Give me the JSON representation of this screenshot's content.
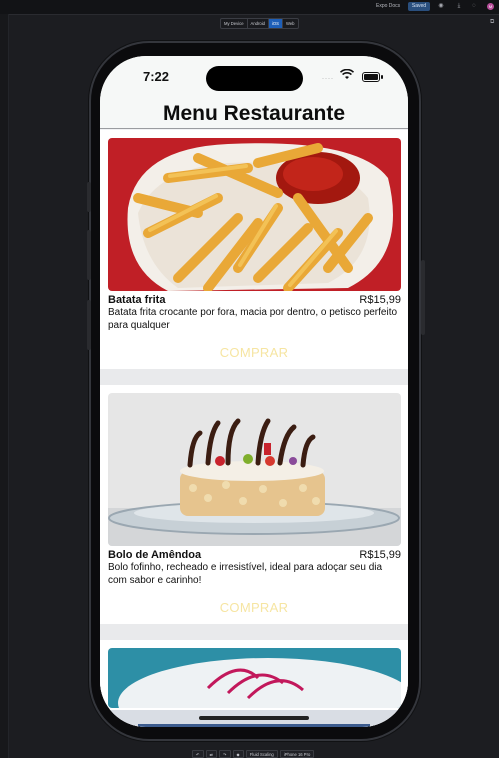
{
  "topbar": {
    "expo_docs_label": "Expo Docs",
    "saved_label": "Saved",
    "icons": [
      "github-icon",
      "download-icon",
      "share-icon",
      "eye-icon"
    ],
    "avatar_initial": "M"
  },
  "device_tabs": [
    {
      "label": "My Device",
      "active": false
    },
    {
      "label": "Android",
      "active": false
    },
    {
      "label": "iOS",
      "active": true
    },
    {
      "label": "Web",
      "active": false
    }
  ],
  "phone": {
    "status": {
      "time": "7:22",
      "signal": "····"
    },
    "app_title": "Menu Restaurante",
    "items": [
      {
        "name": "Batata frita",
        "price": "R$15,99",
        "description": "Batata frita crocante por fora, macia por dentro, o petisco perfeito para qualquer",
        "button_label": "COMPRAR",
        "image": "fries-photo"
      },
      {
        "name": "Bolo de Amêndoa",
        "price": "R$15,99",
        "description": "Bolo fofinho, recheado e irresistível, ideal para adoçar seu dia com sabor e carinho!",
        "button_label": "COMPRAR",
        "image": "almond-cake-photo"
      },
      {
        "name": "",
        "price": "",
        "description": "",
        "button_label": "",
        "image": "dessert-photo"
      }
    ]
  },
  "bottom_tools": [
    "↶",
    "⇄",
    "↷",
    "◆",
    "Fluid Scaling",
    "iPhone 16 Pro"
  ],
  "colors": {
    "accent_button_text": "#f6e5a2",
    "active_tab": "#1e5fb8",
    "saved_button": "#2a4f7e"
  }
}
